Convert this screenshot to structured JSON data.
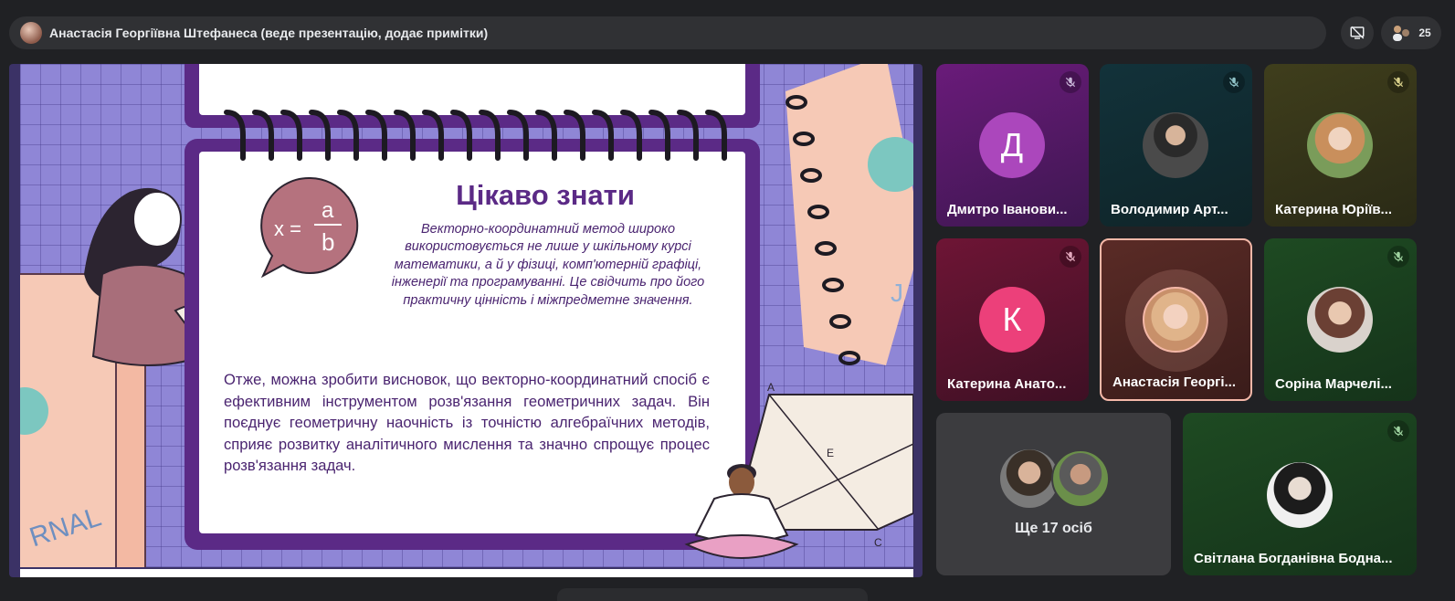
{
  "topbar": {
    "presenter_label": "Анастасія Георгіївна Штефанеса (веде презентацію, додає примітки)",
    "participants_count": "25"
  },
  "slide": {
    "title": "Цікаво знати",
    "note": "Векторно-координатний метод широко використовується не лише у шкільному курсі математики, а й у фізиці, комп'ютерній графіці, інженерії та програмуванні. Це свідчить про його практичну цінність і міжпредметне значення.",
    "body": "Отже, можна зробити висновок, що векторно-координатний спосіб є ефективним інструментом розв'язання геометричних задач. Він поєднує геометричну наочність із точністю алгебраїчних методів, сприяє розвитку аналітичного мислення та значно спрощує процес розв'язання задач.",
    "formula_lhs": "x =",
    "formula_num": "a",
    "formula_den": "b",
    "journal_text": "RNAL",
    "journal_text_right": "J",
    "label_a": "A",
    "label_e": "E",
    "label_c": "C"
  },
  "participants": [
    {
      "name": "Дмитро Іванови...",
      "initial": "Д",
      "avatar_color": "#ab47bc",
      "muted": true
    },
    {
      "name": "Володимир Арт...",
      "muted": true
    },
    {
      "name": "Катерина Юріїв...",
      "muted": true
    },
    {
      "name": "Катерина Анато...",
      "initial": "К",
      "avatar_color": "#ec407a",
      "muted": true
    },
    {
      "name": "Анастасія Георгі...",
      "muted": false,
      "speaking": true
    },
    {
      "name": "Соріна Марчелі...",
      "muted": true
    },
    {
      "label": "Ще 17 осіб"
    },
    {
      "name": "Світлана Богданівна Бодна...",
      "muted": true
    }
  ],
  "colors": {
    "background": "#202124",
    "accent_speaking": "#f4b8a8",
    "mic_muted": "#a8c7fa"
  }
}
